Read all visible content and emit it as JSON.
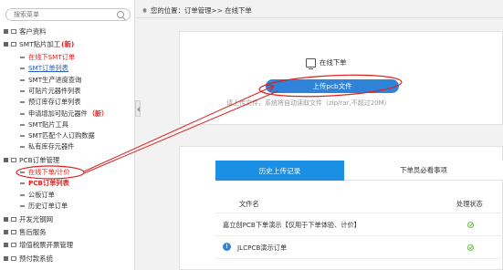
{
  "search": {
    "placeholder": "搜索菜单"
  },
  "sidebar": {
    "groups": [
      {
        "label": "客户资料",
        "new": ""
      },
      {
        "label": "SMT贴片加工",
        "new": "(新)"
      },
      {
        "label": "PCB订单管理",
        "new": ""
      },
      {
        "label": "开发光钢网",
        "new": ""
      },
      {
        "label": "售后服务",
        "new": ""
      },
      {
        "label": "增值税票开票管理",
        "new": ""
      },
      {
        "label": "预付款系统",
        "new": ""
      }
    ],
    "smt_items": [
      {
        "label": "在线下SMT订单",
        "new": ""
      },
      {
        "label": "SMT订单列表",
        "new": ""
      },
      {
        "label": "SMT生产进度查询",
        "new": ""
      },
      {
        "label": "可贴片元器件列表",
        "new": ""
      },
      {
        "label": "预订库存订单列表",
        "new": ""
      },
      {
        "label": "申请增加可贴元器件",
        "new": "（新）"
      },
      {
        "label": "SMT贴片工具",
        "new": ""
      },
      {
        "label": "SMT匹配个人订购数据",
        "new": ""
      },
      {
        "label": "私有库存元器件",
        "new": ""
      }
    ],
    "pcb_items": [
      {
        "label": "在线下单/计价"
      },
      {
        "label": "PCB订单列表"
      },
      {
        "label": "公板订单"
      },
      {
        "label": "历史订单订单"
      }
    ]
  },
  "breadcrumb": {
    "text": "您的位置：订单管理>> 在线下单"
  },
  "upload": {
    "title": "在线下单",
    "button": "上传pcb文件",
    "hint": "请上传文件，系统将自动读取文件（zip/rar,不超过20M）"
  },
  "history": {
    "tabs": [
      "历史上传记录",
      "下单员必看事项"
    ],
    "columns": {
      "file": "文件名",
      "status": "处理状态"
    },
    "rows": [
      {
        "file": "嘉立创PCB下单演示【仅用于下单体验、计价】"
      },
      {
        "file": "JLCPCB演示订单"
      }
    ]
  },
  "colors": {
    "accent": "#1a8fe3",
    "annotation": "#e02020"
  }
}
